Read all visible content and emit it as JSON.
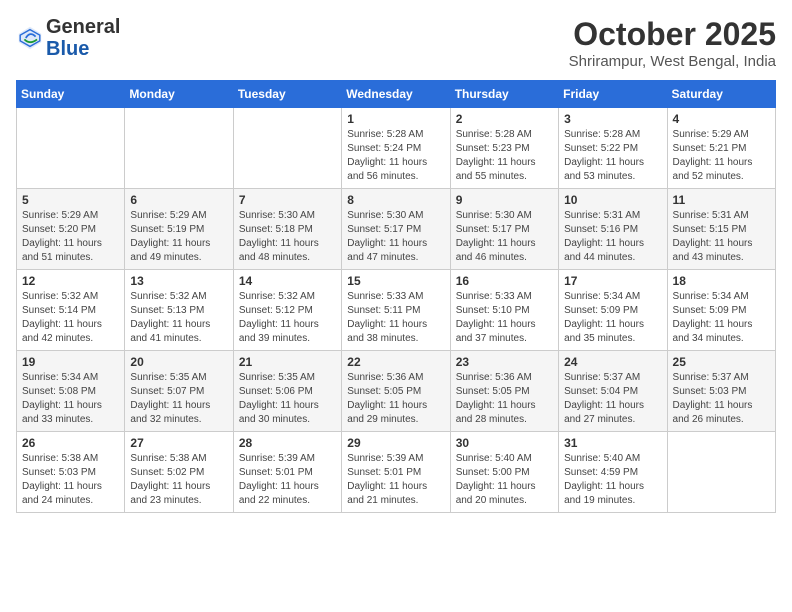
{
  "header": {
    "logo_general": "General",
    "logo_blue": "Blue",
    "month_title": "October 2025",
    "location": "Shrirampur, West Bengal, India"
  },
  "weekdays": [
    "Sunday",
    "Monday",
    "Tuesday",
    "Wednesday",
    "Thursday",
    "Friday",
    "Saturday"
  ],
  "weeks": [
    [
      {
        "day": "",
        "info": ""
      },
      {
        "day": "",
        "info": ""
      },
      {
        "day": "",
        "info": ""
      },
      {
        "day": "1",
        "info": "Sunrise: 5:28 AM\nSunset: 5:24 PM\nDaylight: 11 hours\nand 56 minutes."
      },
      {
        "day": "2",
        "info": "Sunrise: 5:28 AM\nSunset: 5:23 PM\nDaylight: 11 hours\nand 55 minutes."
      },
      {
        "day": "3",
        "info": "Sunrise: 5:28 AM\nSunset: 5:22 PM\nDaylight: 11 hours\nand 53 minutes."
      },
      {
        "day": "4",
        "info": "Sunrise: 5:29 AM\nSunset: 5:21 PM\nDaylight: 11 hours\nand 52 minutes."
      }
    ],
    [
      {
        "day": "5",
        "info": "Sunrise: 5:29 AM\nSunset: 5:20 PM\nDaylight: 11 hours\nand 51 minutes."
      },
      {
        "day": "6",
        "info": "Sunrise: 5:29 AM\nSunset: 5:19 PM\nDaylight: 11 hours\nand 49 minutes."
      },
      {
        "day": "7",
        "info": "Sunrise: 5:30 AM\nSunset: 5:18 PM\nDaylight: 11 hours\nand 48 minutes."
      },
      {
        "day": "8",
        "info": "Sunrise: 5:30 AM\nSunset: 5:17 PM\nDaylight: 11 hours\nand 47 minutes."
      },
      {
        "day": "9",
        "info": "Sunrise: 5:30 AM\nSunset: 5:17 PM\nDaylight: 11 hours\nand 46 minutes."
      },
      {
        "day": "10",
        "info": "Sunrise: 5:31 AM\nSunset: 5:16 PM\nDaylight: 11 hours\nand 44 minutes."
      },
      {
        "day": "11",
        "info": "Sunrise: 5:31 AM\nSunset: 5:15 PM\nDaylight: 11 hours\nand 43 minutes."
      }
    ],
    [
      {
        "day": "12",
        "info": "Sunrise: 5:32 AM\nSunset: 5:14 PM\nDaylight: 11 hours\nand 42 minutes."
      },
      {
        "day": "13",
        "info": "Sunrise: 5:32 AM\nSunset: 5:13 PM\nDaylight: 11 hours\nand 41 minutes."
      },
      {
        "day": "14",
        "info": "Sunrise: 5:32 AM\nSunset: 5:12 PM\nDaylight: 11 hours\nand 39 minutes."
      },
      {
        "day": "15",
        "info": "Sunrise: 5:33 AM\nSunset: 5:11 PM\nDaylight: 11 hours\nand 38 minutes."
      },
      {
        "day": "16",
        "info": "Sunrise: 5:33 AM\nSunset: 5:10 PM\nDaylight: 11 hours\nand 37 minutes."
      },
      {
        "day": "17",
        "info": "Sunrise: 5:34 AM\nSunset: 5:09 PM\nDaylight: 11 hours\nand 35 minutes."
      },
      {
        "day": "18",
        "info": "Sunrise: 5:34 AM\nSunset: 5:09 PM\nDaylight: 11 hours\nand 34 minutes."
      }
    ],
    [
      {
        "day": "19",
        "info": "Sunrise: 5:34 AM\nSunset: 5:08 PM\nDaylight: 11 hours\nand 33 minutes."
      },
      {
        "day": "20",
        "info": "Sunrise: 5:35 AM\nSunset: 5:07 PM\nDaylight: 11 hours\nand 32 minutes."
      },
      {
        "day": "21",
        "info": "Sunrise: 5:35 AM\nSunset: 5:06 PM\nDaylight: 11 hours\nand 30 minutes."
      },
      {
        "day": "22",
        "info": "Sunrise: 5:36 AM\nSunset: 5:05 PM\nDaylight: 11 hours\nand 29 minutes."
      },
      {
        "day": "23",
        "info": "Sunrise: 5:36 AM\nSunset: 5:05 PM\nDaylight: 11 hours\nand 28 minutes."
      },
      {
        "day": "24",
        "info": "Sunrise: 5:37 AM\nSunset: 5:04 PM\nDaylight: 11 hours\nand 27 minutes."
      },
      {
        "day": "25",
        "info": "Sunrise: 5:37 AM\nSunset: 5:03 PM\nDaylight: 11 hours\nand 26 minutes."
      }
    ],
    [
      {
        "day": "26",
        "info": "Sunrise: 5:38 AM\nSunset: 5:03 PM\nDaylight: 11 hours\nand 24 minutes."
      },
      {
        "day": "27",
        "info": "Sunrise: 5:38 AM\nSunset: 5:02 PM\nDaylight: 11 hours\nand 23 minutes."
      },
      {
        "day": "28",
        "info": "Sunrise: 5:39 AM\nSunset: 5:01 PM\nDaylight: 11 hours\nand 22 minutes."
      },
      {
        "day": "29",
        "info": "Sunrise: 5:39 AM\nSunset: 5:01 PM\nDaylight: 11 hours\nand 21 minutes."
      },
      {
        "day": "30",
        "info": "Sunrise: 5:40 AM\nSunset: 5:00 PM\nDaylight: 11 hours\nand 20 minutes."
      },
      {
        "day": "31",
        "info": "Sunrise: 5:40 AM\nSunset: 4:59 PM\nDaylight: 11 hours\nand 19 minutes."
      },
      {
        "day": "",
        "info": ""
      }
    ]
  ]
}
